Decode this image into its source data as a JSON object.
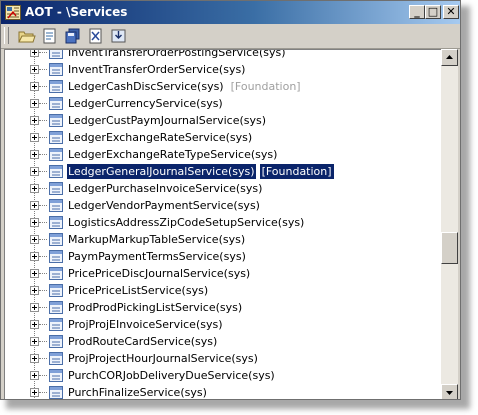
{
  "window": {
    "title": "AOT - \\Services",
    "minimize_glyph": "_",
    "maximize_glyph": "□",
    "close_glyph": "✕"
  },
  "toolbar": {
    "buttons": [
      "open-icon",
      "properties-icon",
      "save-all-icon",
      "compile-icon",
      "import-icon"
    ]
  },
  "tree": {
    "selected_index": 7,
    "items": [
      {
        "label": "InventTransferOrderPostingService(sys)",
        "layer": ""
      },
      {
        "label": "InventTransferOrderService(sys)",
        "layer": ""
      },
      {
        "label": "LedgerCashDiscService(sys)",
        "layer": "[Foundation]"
      },
      {
        "label": "LedgerCurrencyService(sys)",
        "layer": ""
      },
      {
        "label": "LedgerCustPaymJournalService(sys)",
        "layer": ""
      },
      {
        "label": "LedgerExchangeRateService(sys)",
        "layer": ""
      },
      {
        "label": "LedgerExchangeRateTypeService(sys)",
        "layer": ""
      },
      {
        "label": "LedgerGeneralJournalService(sys)",
        "layer": "[Foundation]"
      },
      {
        "label": "LedgerPurchaseInvoiceService(sys)",
        "layer": ""
      },
      {
        "label": "LedgerVendorPaymentService(sys)",
        "layer": ""
      },
      {
        "label": "LogisticsAddressZipCodeSetupService(sys)",
        "layer": ""
      },
      {
        "label": "MarkupMarkupTableService(sys)",
        "layer": ""
      },
      {
        "label": "PaymPaymentTermsService(sys)",
        "layer": ""
      },
      {
        "label": "PricePriceDiscJournalService(sys)",
        "layer": ""
      },
      {
        "label": "PricePriceListService(sys)",
        "layer": ""
      },
      {
        "label": "ProdProdPickingListService(sys)",
        "layer": ""
      },
      {
        "label": "ProjProjEInvoiceService(sys)",
        "layer": ""
      },
      {
        "label": "ProdRouteCardService(sys)",
        "layer": ""
      },
      {
        "label": "ProjProjectHourJournalService(sys)",
        "layer": ""
      },
      {
        "label": "PurchCORJobDeliveryDueService(sys)",
        "layer": ""
      },
      {
        "label": "PurchFinalizeService(sys)",
        "layer": ""
      }
    ]
  },
  "scrollbar": {
    "up_glyph": "▲",
    "down_glyph": "▼",
    "position_fraction": 0.58,
    "visible_fraction": 0.1
  },
  "colors": {
    "selection": "#0a246a",
    "titlebar_start": "#0a246a",
    "titlebar_end": "#a6caf0",
    "layer_dim": "#a0a0a0"
  }
}
